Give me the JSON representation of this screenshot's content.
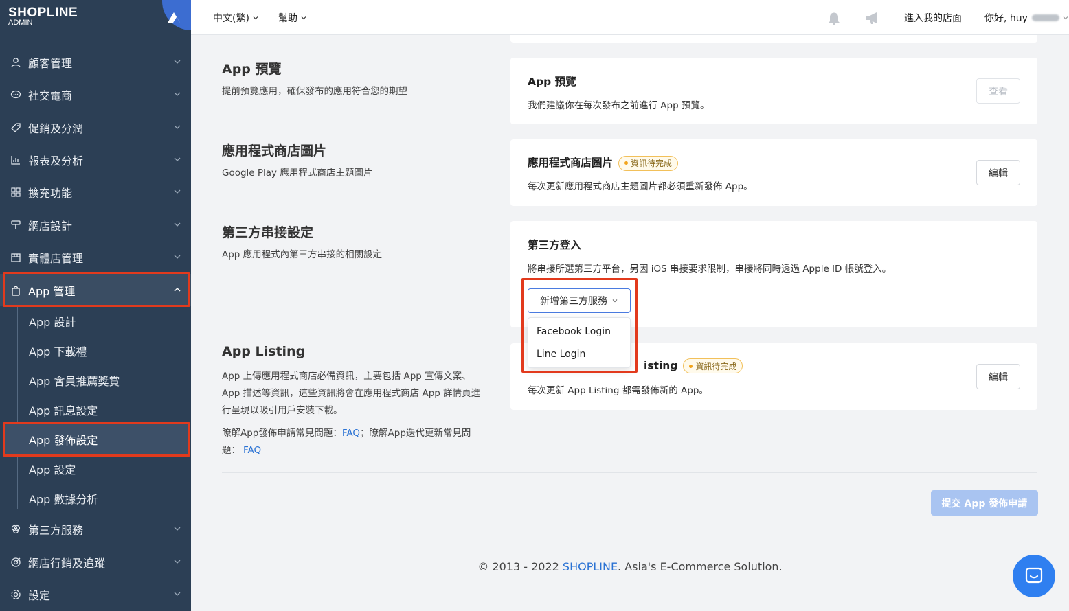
{
  "brand": {
    "logo": "SHOPLINE",
    "sub": "ADMIN"
  },
  "sidebar": {
    "items": [
      {
        "label": "顧客管理",
        "icon": "user-icon"
      },
      {
        "label": "社交電商",
        "icon": "chat-icon"
      },
      {
        "label": "促銷及分潤",
        "icon": "tag-icon"
      },
      {
        "label": "報表及分析",
        "icon": "chart-icon"
      },
      {
        "label": "擴充功能",
        "icon": "grid-icon"
      },
      {
        "label": "網店設計",
        "icon": "paint-icon"
      },
      {
        "label": "實體店管理",
        "icon": "store-icon"
      },
      {
        "label": "App 管理",
        "icon": "bag-icon"
      },
      {
        "label": "第三方服務",
        "icon": "circles-icon"
      },
      {
        "label": "網店行銷及追蹤",
        "icon": "target-icon"
      },
      {
        "label": "設定",
        "icon": "gear-icon"
      }
    ],
    "sub_items": [
      {
        "label": "App 設計"
      },
      {
        "label": "App 下載禮"
      },
      {
        "label": "App 會員推薦獎賞"
      },
      {
        "label": "App 訊息設定"
      },
      {
        "label": "App 發佈設定"
      },
      {
        "label": "App 設定"
      },
      {
        "label": "App 數據分析"
      }
    ]
  },
  "topbar": {
    "language": "中文(繁)",
    "help": "幫助",
    "enter_store": "進入我的店面",
    "greeting": "你好, huy"
  },
  "sections": {
    "preview": {
      "title": "App 預覽",
      "desc": "提前預覽應用，確保發布的應用符合您的期望",
      "card_title": "App 預覽",
      "card_desc": "我們建議你在每次發布之前進行 App 預覽。",
      "button": "查看"
    },
    "store_images": {
      "title": "應用程式商店圖片",
      "desc": "Google Play 應用程式商店主題圖片",
      "card_title": "應用程式商店圖片",
      "badge": "資訊待完成",
      "card_desc": "每次更新應用程式商店主題圖片都必須重新發佈 App。",
      "button": "編輯"
    },
    "third_party": {
      "title": "第三方串接設定",
      "desc": "App 應用程式內第三方串接的相關設定",
      "card_title": "第三方登入",
      "card_desc": "將串接所選第三方平台，另因 iOS 串接要求限制，串接將同時透過 Apple ID 帳號登入。",
      "dropdown": "新增第三方服務",
      "menu": [
        "Facebook Login",
        "Line Login"
      ]
    },
    "listing": {
      "title": "App Listing",
      "desc_lines": [
        "App 上傳應用程式商店必備資訊，主要包括 App 宣傳文案、",
        "App 描述等資訊，這些資訊將會在應用程式商店 App 詳情頁進",
        "行呈現以吸引用戶安裝下載。"
      ],
      "faq_prefix1": "瞭解App發佈申請常見問題：",
      "faq_link1": "FAQ",
      "faq_mid": "；瞭解App迭代更新常見問",
      "faq_prefix2": "題：",
      "faq_link2": "FAQ",
      "card_title_visible": "isting",
      "badge": "資訊待完成",
      "card_desc": "每次更新 App Listing 都需發佈新的 App。",
      "button": "編輯"
    }
  },
  "submit_button": "提交 App 發佈申請",
  "footer": {
    "prefix": "© 2013 - 2022",
    "brand": "SHOPLINE",
    "suffix": ". Asia's E-Commerce Solution."
  },
  "colors": {
    "sidebar_bg": "#2c3f55",
    "accent": "#2a72d4",
    "highlight": "#e23a1d",
    "badge_border": "#f2c05a"
  }
}
